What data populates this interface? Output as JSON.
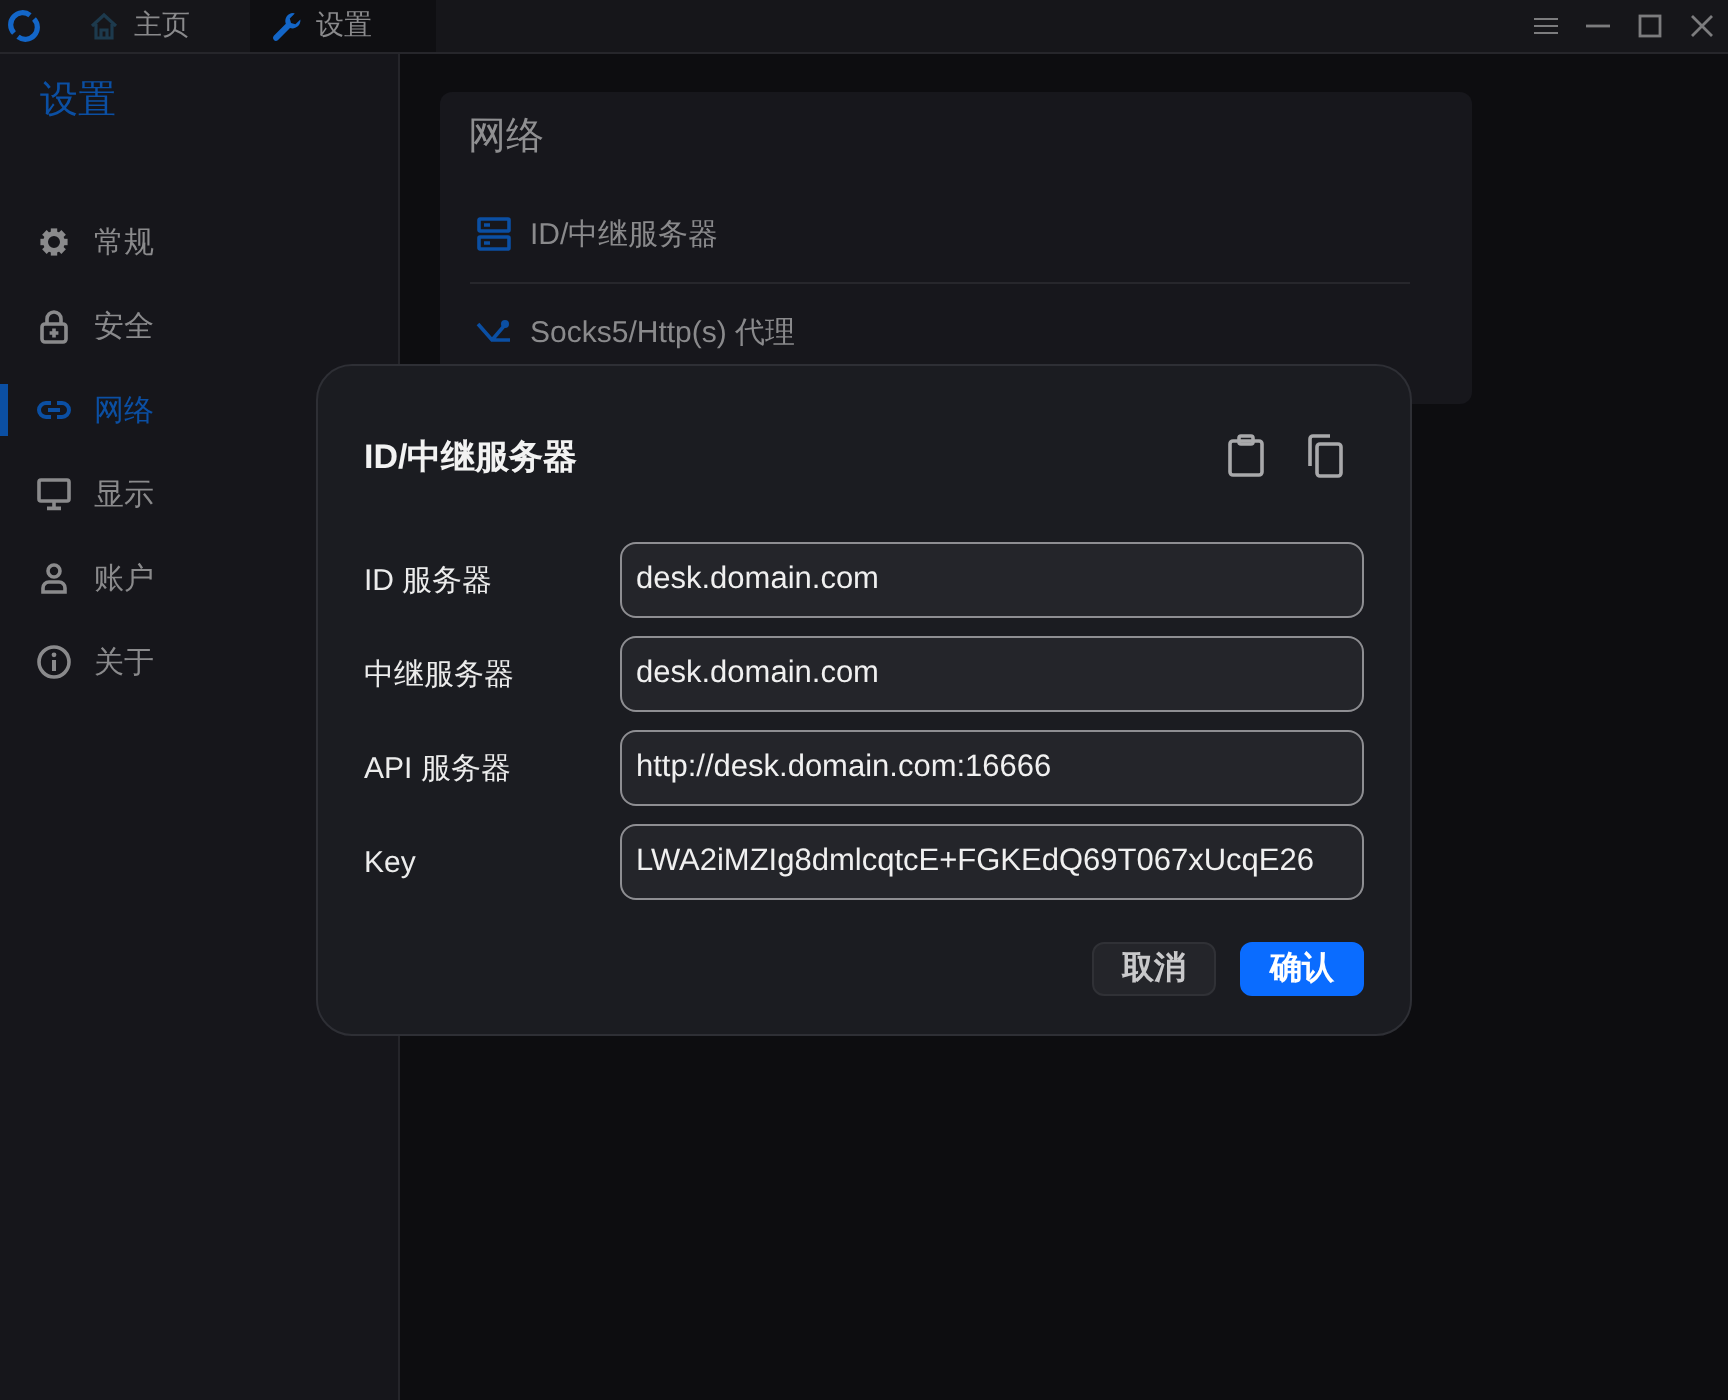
{
  "titlebar": {
    "tabs": [
      {
        "label": "主页",
        "selected": false
      },
      {
        "label": "设置",
        "selected": true
      }
    ]
  },
  "sidebar": {
    "title": "设置",
    "items": [
      {
        "label": "常规",
        "selected": false
      },
      {
        "label": "安全",
        "selected": false
      },
      {
        "label": "网络",
        "selected": true
      },
      {
        "label": "显示",
        "selected": false
      },
      {
        "label": "账户",
        "selected": false
      },
      {
        "label": "关于",
        "selected": false
      }
    ]
  },
  "panel": {
    "title": "网络",
    "items": [
      {
        "label": "ID/中继服务器"
      },
      {
        "label": "Socks5/Http(s) 代理"
      }
    ]
  },
  "dialog": {
    "title": "ID/中继服务器",
    "fields": [
      {
        "label": "ID 服务器",
        "value": "desk.domain.com"
      },
      {
        "label": "中继服务器",
        "value": "desk.domain.com"
      },
      {
        "label": "API 服务器",
        "value": "http://desk.domain.com:16666"
      },
      {
        "label": "Key",
        "value": "LWA2iMZIg8dmlcqtcE+FGKEdQ69T067xUcqE26"
      }
    ],
    "buttons": [
      {
        "label": "取消",
        "kind": "secondary"
      },
      {
        "label": "确认",
        "kind": "primary"
      }
    ]
  }
}
